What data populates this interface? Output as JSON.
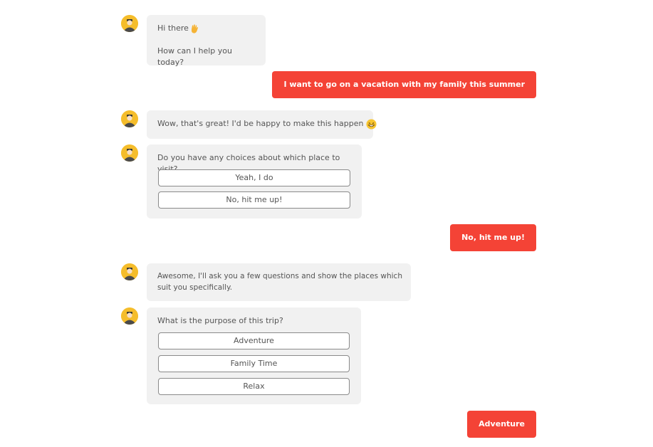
{
  "messages": {
    "m1": {
      "line1": "Hi there",
      "line2": "How can I help you today?"
    },
    "m2": {
      "text": "I want to go on a vacation with my family this summer"
    },
    "m3": {
      "text": "Wow, that's great! I'd be happy to make this happen"
    },
    "m4": {
      "question": "Do you have any choices about which place to visit?",
      "options": [
        "Yeah, I do",
        "No, hit me up!"
      ]
    },
    "m5": {
      "text": "No, hit me up!"
    },
    "m6": {
      "line1": "Awesome, I'll ask you a few questions and show the places which",
      "line2": "suit you specifically."
    },
    "m7": {
      "question": "What is the purpose of this trip?",
      "options": [
        "Adventure",
        "Family Time",
        "Relax"
      ]
    },
    "m8": {
      "text": "Adventure"
    }
  },
  "icons": {
    "avatar": "bot-avatar-icon",
    "wave": "waving-hand-icon",
    "grin": "grinning-face-icon"
  },
  "colors": {
    "user_bubble": "#f44336",
    "bot_bubble": "#f1f1f1",
    "avatar": "#f5bd2b"
  }
}
